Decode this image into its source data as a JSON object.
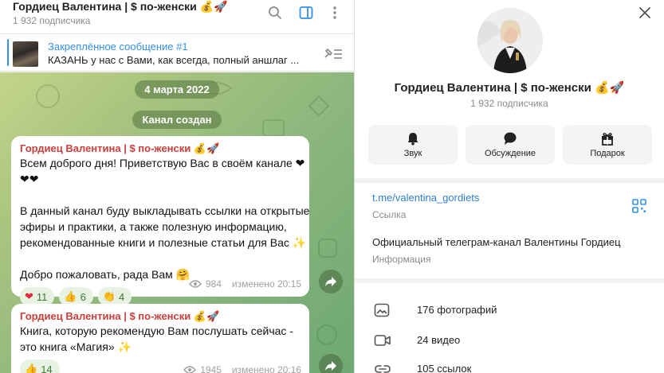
{
  "chat": {
    "header": {
      "title": "Гордиец Валентина | $ по-женски 💰🚀",
      "subscribers": "1 932 подписчика",
      "icons": [
        "search-icon",
        "sidebar-toggle-icon",
        "more-vertical-icon"
      ]
    },
    "pinned": {
      "title": "Закреплённое сообщение #1",
      "text": "КАЗАНЬ у нас с Вами, как всегда, полный аншлаг ...",
      "action_icon": "unpin-list-icon"
    },
    "date_label": "4 марта 2022",
    "service_label": "Канал создан",
    "messages": [
      {
        "author": "Гордиец Валентина | $ по-женски 💰🚀",
        "lines": [
          "Всем доброго дня! Приветствую Вас в своём канале ❤",
          "❤❤",
          "",
          "В данный канал буду выкладывать ссылки на открытые",
          "эфиры и практики, а также полезную информацию,",
          "рекомендованные книги и полезные статьи для Вас ✨",
          "",
          "Добро пожаловать, рада Вам 🤗"
        ],
        "reactions": [
          {
            "emoji": "❤",
            "count": "11"
          },
          {
            "emoji": "👍",
            "count": "6"
          },
          {
            "emoji": "👏",
            "count": "4"
          }
        ],
        "views": "984",
        "edited": "изменено 20:15"
      },
      {
        "author": "Гордиец Валентина | $ по-женски 💰🚀",
        "lines": [
          "Книга, которую рекомендую Вам послушать сейчас -",
          "это книга «Магия» ✨"
        ],
        "reactions": [
          {
            "emoji": "👍",
            "count": "14"
          }
        ],
        "views": "1945",
        "edited": "изменено 20:16"
      }
    ]
  },
  "profile": {
    "name": "Гордиец Валентина | $ по-женски 💰🚀",
    "subscribers": "1 932 подписчика",
    "actions": [
      {
        "label": "Звук",
        "icon": "bell-icon"
      },
      {
        "label": "Обсуждение",
        "icon": "chat-bubble-icon"
      },
      {
        "label": "Подарок",
        "icon": "gift-icon"
      }
    ],
    "link": "t.me/valentina_gordiets",
    "link_caption": "Ссылка",
    "about": "Официальный телеграм-канал Валентины Гордиец",
    "about_caption": "Информация",
    "media": [
      {
        "label": "176 фотографий",
        "icon": "photo-icon"
      },
      {
        "label": "24 видео",
        "icon": "video-icon"
      },
      {
        "label": "105 ссылок",
        "icon": "link-icon"
      }
    ]
  },
  "colors": {
    "accent": "#3390ec",
    "author": "#c9403a",
    "reaction_bg": "#e8f2e2",
    "reaction_text": "#3d7a31"
  }
}
